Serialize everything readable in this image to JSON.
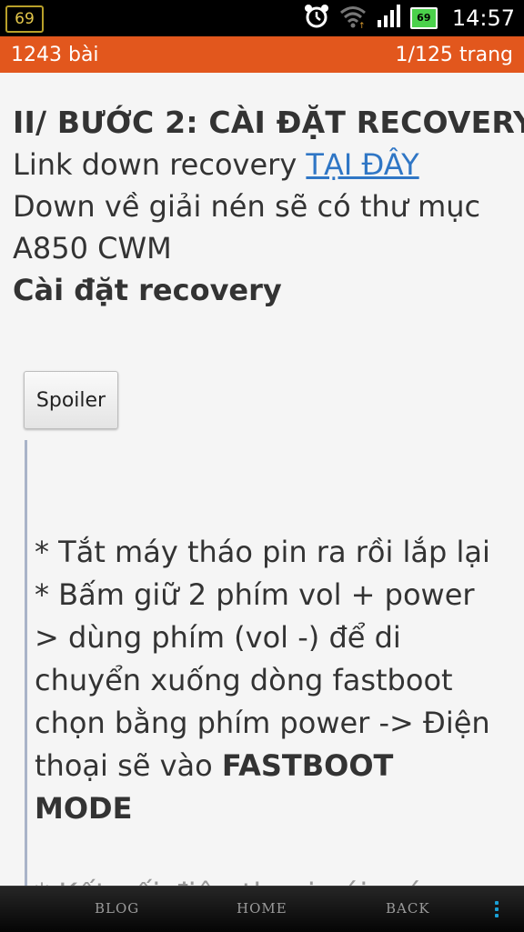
{
  "status_bar": {
    "left_badge": "69",
    "battery_level": "69",
    "time": "14:57",
    "icons": [
      "alarm-clock-icon",
      "wifi-icon",
      "signal-icon",
      "battery-icon"
    ]
  },
  "header": {
    "post_count": "1243 bài",
    "page_info": "1/125 trang"
  },
  "article": {
    "heading": "II/ BƯỚC 2: CÀI ĐẶT RECOVERY",
    "link_prefix": "Link down recovery ",
    "link_text": "TẠI ĐÂY",
    "line_extract": "Down về giải nén sẽ có thư mục A850 CWM",
    "subheading": "Cài đặt recovery",
    "spoiler_label": "Spoiler",
    "spoiler": {
      "step1": "* Tắt máy tháo pin ra rồi lắp lại",
      "step2_text": "* Bấm giữ 2 phím vol + power > dùng phím (vol -) để di chuyển xuống dòng fastboot chọn bằng phím power -> Điện thoại sẽ vào ",
      "step2_bold": "FASTBOOT MODE",
      "step3_partial": "* Kết nối điện thoại với máy tính"
    }
  },
  "bottom_nav": {
    "blog": "BLOG",
    "home": "HOME",
    "back": "BACK"
  },
  "colors": {
    "header_bg": "#e2571d",
    "link": "#2f76c5",
    "nav_dots": "#1aa0d6"
  }
}
